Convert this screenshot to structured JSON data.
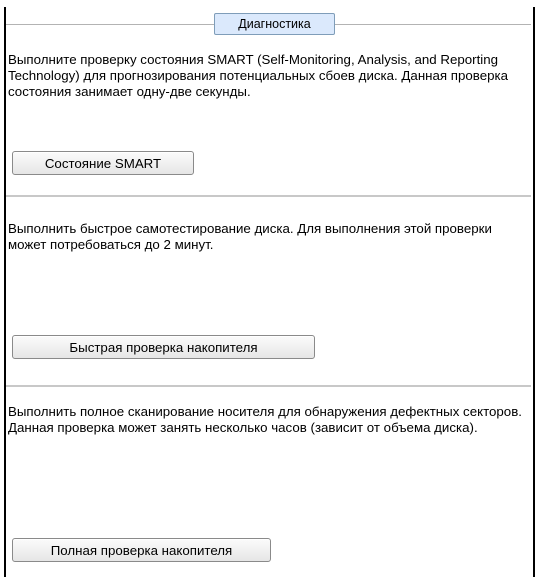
{
  "panel": {
    "tab_label": "Диагностика"
  },
  "sections": [
    {
      "description": "Выполните проверку состояния SMART (Self-Monitoring, Analysis, and Reporting Technology) для прогнозирования потенциальных сбоев диска. Данная проверка состояния занимает одну-две секунды.",
      "button_label": "Состояние SMART"
    },
    {
      "description": "Выполнить быстрое самотестирование диска. Для выполнения этой проверки может потребоваться до 2 минут.",
      "button_label": "Быстрая проверка накопителя"
    },
    {
      "description": "Выполнить полное сканирование носителя для обнаружения дефектных секторов. Данная проверка может занять несколько часов (зависит от объема диска).",
      "button_label": "Полная проверка накопителя"
    }
  ]
}
